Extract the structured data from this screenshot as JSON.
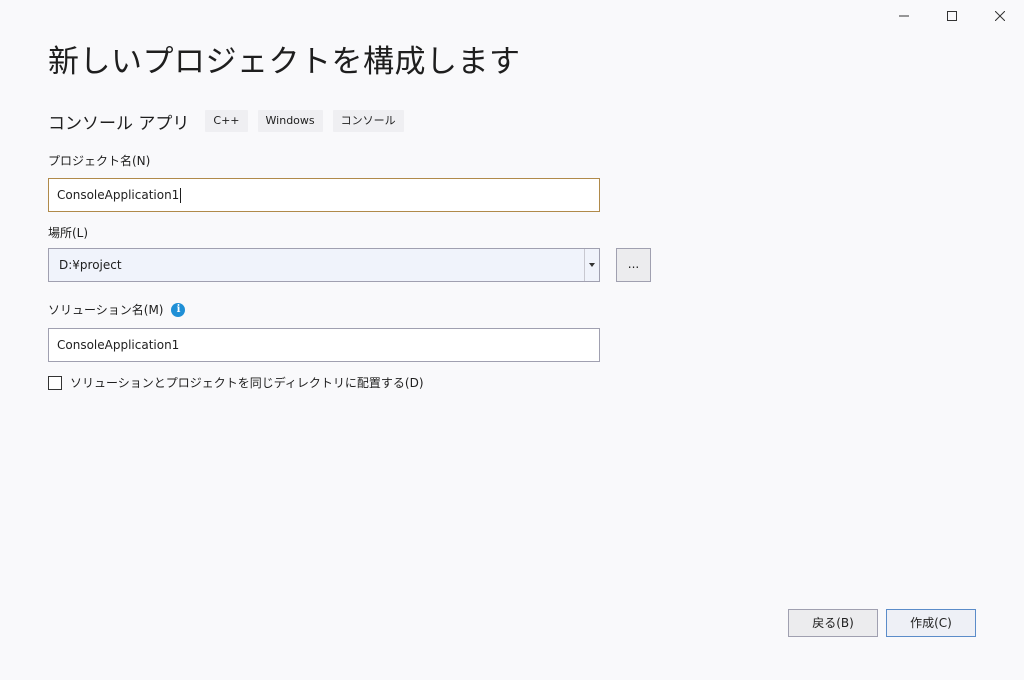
{
  "window": {
    "minimize_icon": "minimize-icon",
    "maximize_icon": "maximize-icon",
    "close_icon": "close-icon"
  },
  "page_title": "新しいプロジェクトを構成します",
  "template": {
    "name": "コンソール アプリ",
    "tags": [
      "C++",
      "Windows",
      "コンソール"
    ]
  },
  "project_name": {
    "label": "プロジェクト名(N)",
    "value": "ConsoleApplication1"
  },
  "location": {
    "label": "場所(L)",
    "value": "D:¥project",
    "browse_label": "..."
  },
  "solution_name": {
    "label": "ソリューション名(M)",
    "info_icon": "info-icon",
    "value": "ConsoleApplication1"
  },
  "same_directory": {
    "label": "ソリューションとプロジェクトを同じディレクトリに配置する(D)",
    "checked": false
  },
  "footer": {
    "back_label": "戻る(B)",
    "create_label": "作成(C)"
  },
  "colors": {
    "accent": "#1f8fd6",
    "focus_border": "#b08a4a",
    "primary_button_border": "#5b8cc9",
    "background": "#f9f9fb"
  }
}
